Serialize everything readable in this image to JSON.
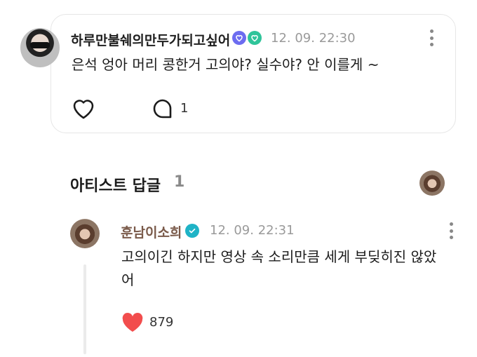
{
  "fan_comment": {
    "username": "하루만불쉐의만두가되고싶어",
    "timestamp": "12. 09. 22:30",
    "text": "은석 엉아 머리 콩한거 고의야? 실수야? 안 이를게 ~",
    "reply_count": "1",
    "badges": [
      "heart-badge-icon",
      "check-badge-icon"
    ],
    "badge_colors": [
      "#6c6cf0",
      "#2fc49a"
    ]
  },
  "artist_section": {
    "title": "아티스트 답글",
    "count": "1"
  },
  "artist_reply": {
    "username": "훈남이소희",
    "timestamp": "12. 09. 22:31",
    "text": "고의이긴 하지만 영상 속 소리만큼 세게 부딪히진 않았어",
    "like_count": "879",
    "verified_color": "#1fb3c6",
    "like_color": "#f24d4d"
  }
}
